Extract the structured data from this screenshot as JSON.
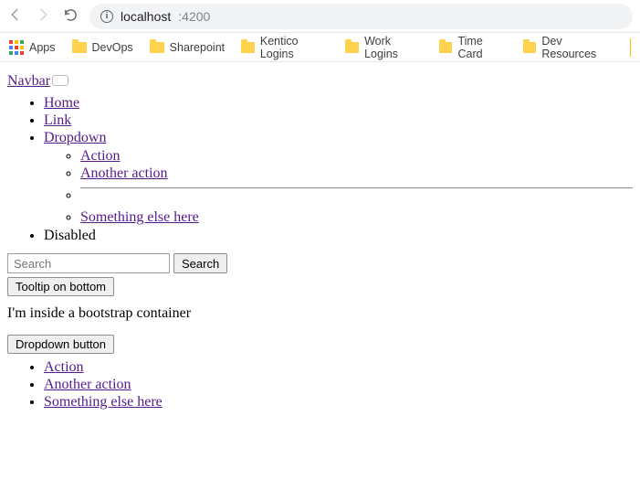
{
  "browser": {
    "url_host": "localhost",
    "url_port": ":4200",
    "info_glyph": "i"
  },
  "bookmarks": {
    "apps_label": "Apps",
    "apps_colors": [
      "#ea4335",
      "#fbbc04",
      "#34a853",
      "#4285f4",
      "#ea4335",
      "#fbbc04",
      "#34a853",
      "#4285f4",
      "#ea4335"
    ],
    "items": [
      {
        "label": "DevOps"
      },
      {
        "label": "Sharepoint"
      },
      {
        "label": "Kentico Logins"
      },
      {
        "label": "Work Logins"
      },
      {
        "label": "Time Card"
      },
      {
        "label": "Dev Resources"
      }
    ]
  },
  "navbar": {
    "brand": "Navbar",
    "items": [
      {
        "label": "Home",
        "link": true
      },
      {
        "label": "Link",
        "link": true
      },
      {
        "label": "Dropdown",
        "link": true
      },
      {
        "label": "Disabled",
        "link": false
      }
    ],
    "dropdown": {
      "items": [
        "Action",
        "Another action",
        "Something else here"
      ]
    }
  },
  "search": {
    "placeholder": "Search",
    "button_label": "Search"
  },
  "tooltip_button_label": "Tooltip on bottom",
  "container_text": "I'm inside a bootstrap container",
  "dropdown_button": {
    "label": "Dropdown button",
    "items": [
      "Action",
      "Another action",
      "Something else here"
    ]
  }
}
